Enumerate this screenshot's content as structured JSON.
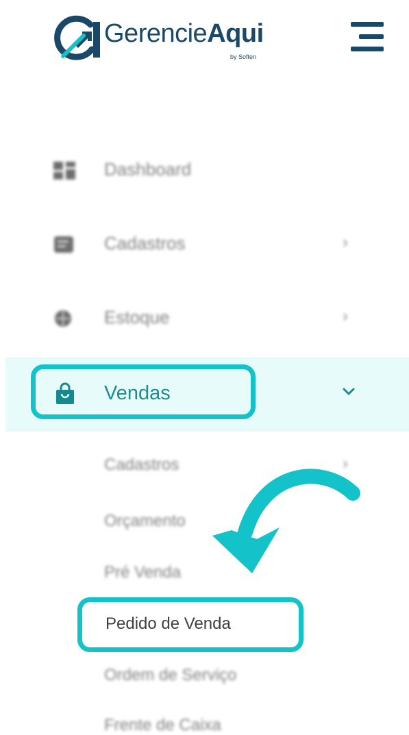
{
  "brand": {
    "name_part1": "Gerencie",
    "name_part2": "Aqui",
    "byline": "by Soften",
    "logo_mark": "GA"
  },
  "menu": [
    {
      "label": "Dashboard",
      "icon": "dashboard-icon",
      "chevron": ""
    },
    {
      "label": "Cadastros",
      "icon": "cadastros-icon",
      "chevron": "›"
    },
    {
      "label": "Estoque",
      "icon": "estoque-icon",
      "chevron": "›"
    }
  ],
  "active_menu": {
    "label": "Vendas",
    "icon": "shopping-bag-icon",
    "chevron": "chevron-down-icon"
  },
  "submenu": [
    {
      "label": "Cadastros",
      "chevron": "›"
    },
    {
      "label": "Orçamento"
    },
    {
      "label": "Pré Venda"
    },
    {
      "label": "Pedido de Venda"
    },
    {
      "label": "Ordem de Serviço"
    },
    {
      "label": "Frente de Caixa"
    }
  ],
  "colors": {
    "brand_navy": "#1a4869",
    "accent_teal": "#14c3c9",
    "active_bg": "#e8fbfb",
    "active_text": "#1a8d93"
  }
}
